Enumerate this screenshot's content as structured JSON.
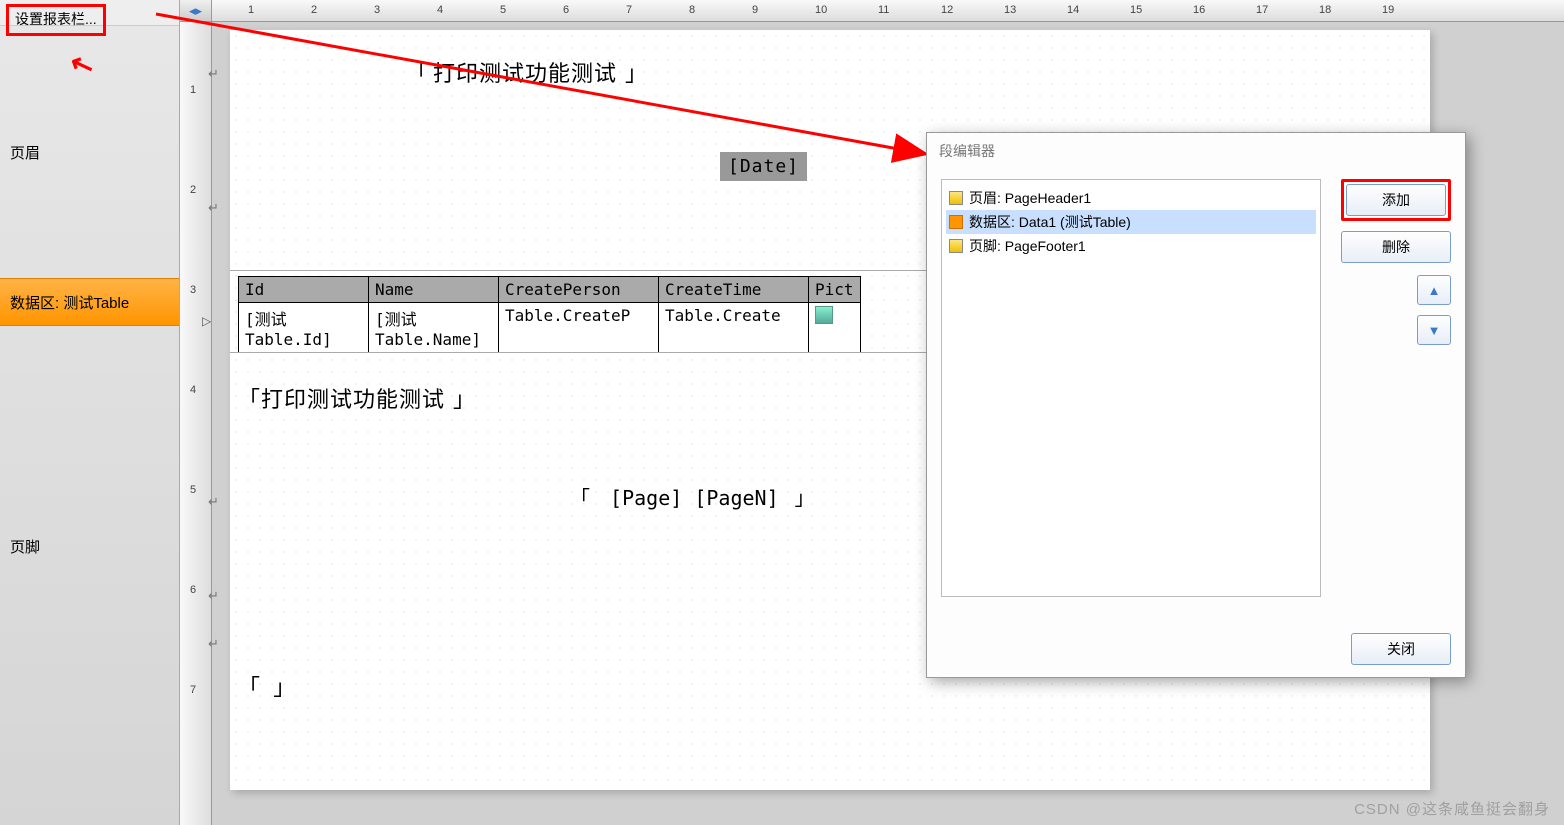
{
  "sidebar": {
    "set_report": "设置报表栏...",
    "bands": {
      "header": "页眉",
      "data": "数据区: 测试Table",
      "footer": "页脚"
    }
  },
  "ruler": {
    "hticks": [
      "1",
      "2",
      "3",
      "4",
      "5",
      "6",
      "7",
      "8",
      "9",
      "10",
      "11",
      "12",
      "13",
      "14",
      "15",
      "16",
      "17",
      "18",
      "19"
    ],
    "vticks": [
      "1",
      "2",
      "3",
      "4",
      "5",
      "6",
      "7"
    ]
  },
  "page": {
    "title1": "打印测试功能测试",
    "date_ph": "[Date]",
    "title2": "打印测试功能测试",
    "page_ph": "[Page]   [PageN]",
    "empty_brackets": "「                                                                              」"
  },
  "table": {
    "headers": [
      "Id",
      "Name",
      "CreatePerson",
      "CreateTime",
      "Pict"
    ],
    "row": [
      "[测试Table.Id]",
      "[测试Table.Name]",
      "Table.CreateP",
      "Table.Create",
      ""
    ]
  },
  "dialog": {
    "title": "段编辑器",
    "items": [
      {
        "icon": "ic-y",
        "label": "页眉: PageHeader1",
        "sel": false
      },
      {
        "icon": "ic-o",
        "label": "数据区: Data1 (测试Table)",
        "sel": true
      },
      {
        "icon": "ic-y",
        "label": "页脚: PageFooter1",
        "sel": false
      }
    ],
    "buttons": {
      "add": "添加",
      "delete": "删除",
      "close": "关闭"
    }
  },
  "watermark": "CSDN @这条咸鱼挺会翻身"
}
